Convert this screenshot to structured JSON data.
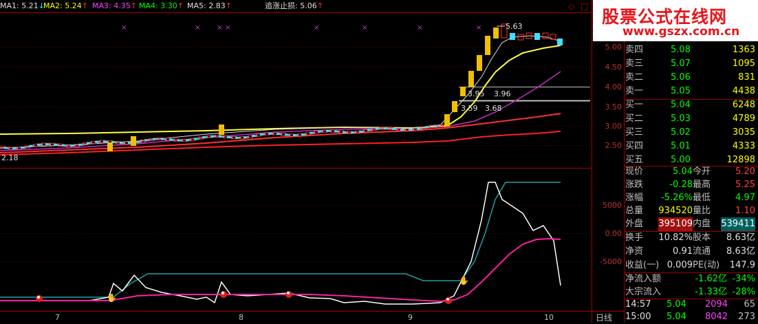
{
  "ma_bar": {
    "items": [
      {
        "label": "MA1: 5.21",
        "arrow": "↓",
        "color": "#e0e0e0"
      },
      {
        "label": "MA2: 5.24",
        "arrow": "↑",
        "color": "#ffff00"
      },
      {
        "label": "MA3: 4.35",
        "arrow": "↑",
        "color": "#ff40ff"
      },
      {
        "label": "MA4: 3.30",
        "arrow": "↑",
        "color": "#00ff00"
      },
      {
        "label": "MA5: 2.83",
        "arrow": "↑",
        "color": "#e0e0e0"
      }
    ],
    "stop_label": "追涨止损: 5.06",
    "stop_arrow": "↑"
  },
  "price_axis": [
    "5.00",
    "4.50",
    "4.00",
    "3.50",
    "3.00",
    "2.50"
  ],
  "indicator_axis": [
    "5000",
    "0.00",
    "-5000"
  ],
  "x_axis": [
    "7",
    "8",
    "9",
    "10"
  ],
  "period_label": "日线",
  "annotations": {
    "high": "5.63",
    "low": "2.18",
    "level1": "3.95",
    "level1b": "3.96",
    "level2": "3.59",
    "level2b": "3.68"
  },
  "watermark": {
    "line1": "股票公式在线网",
    "line2": "www.gszx.com.cn"
  },
  "icons": {
    "diamond": "◇",
    "close": "□"
  },
  "order_book": {
    "asks": [
      {
        "label": "卖四",
        "price": "5.08",
        "vol": "1363"
      },
      {
        "label": "卖三",
        "price": "5.07",
        "vol": "1095"
      },
      {
        "label": "卖二",
        "price": "5.06",
        "vol": "831"
      },
      {
        "label": "卖一",
        "price": "5.05",
        "vol": "4438"
      }
    ],
    "bids": [
      {
        "label": "买一",
        "price": "5.04",
        "vol": "6248"
      },
      {
        "label": "买二",
        "price": "5.03",
        "vol": "4789"
      },
      {
        "label": "买三",
        "price": "5.02",
        "vol": "3035"
      },
      {
        "label": "买四",
        "price": "5.01",
        "vol": "4333"
      },
      {
        "label": "买五",
        "price": "5.00",
        "vol": "12898"
      }
    ]
  },
  "quote": [
    {
      "l1": "现价",
      "v1": "5.04",
      "l2": "今开",
      "v2": "5.20",
      "c1": "green",
      "c2": "red"
    },
    {
      "l1": "涨跌",
      "v1": "-0.28",
      "l2": "最高",
      "v2": "5.25",
      "c1": "green",
      "c2": "red"
    },
    {
      "l1": "涨幅",
      "v1": "-5.26%",
      "l2": "最低",
      "v2": "4.97",
      "c1": "green",
      "c2": "green"
    },
    {
      "l1": "总量",
      "v1": "934520",
      "l2": "量比",
      "v2": "1.10",
      "c1": "yellow",
      "c2": "red"
    },
    {
      "l1": "外盘",
      "v1": "395109",
      "l2": "内盘",
      "v2": "539411",
      "c1": "hl-red",
      "c2": "hl-cyan"
    }
  ],
  "finance": [
    {
      "l1": "换手",
      "v1": "10.82%",
      "l2": "股本",
      "v2": "8.63亿"
    },
    {
      "l1": "净资",
      "v1": "0.91",
      "l2": "流通",
      "v2": "8.63亿"
    },
    {
      "l1": "收益(一)",
      "v1": "0.009",
      "l2": "PE(动)",
      "v2": "147.9"
    }
  ],
  "flow": [
    {
      "label": "净流入额",
      "v1": "-1.62亿",
      "v2": "-34%"
    },
    {
      "label": "大宗流入",
      "v1": "-1.33亿",
      "v2": "-28%"
    }
  ],
  "ticks": [
    {
      "time": "14:57",
      "price": "5.04",
      "vol": "2094",
      "n": "65"
    },
    {
      "time": "15:00",
      "price": "5.04",
      "vol": "8042",
      "n": "273"
    }
  ],
  "colors": {
    "up": "#ff3030",
    "down": "#00ffff",
    "ma_yellow": "#ffff00",
    "grid": "#a00000"
  }
}
